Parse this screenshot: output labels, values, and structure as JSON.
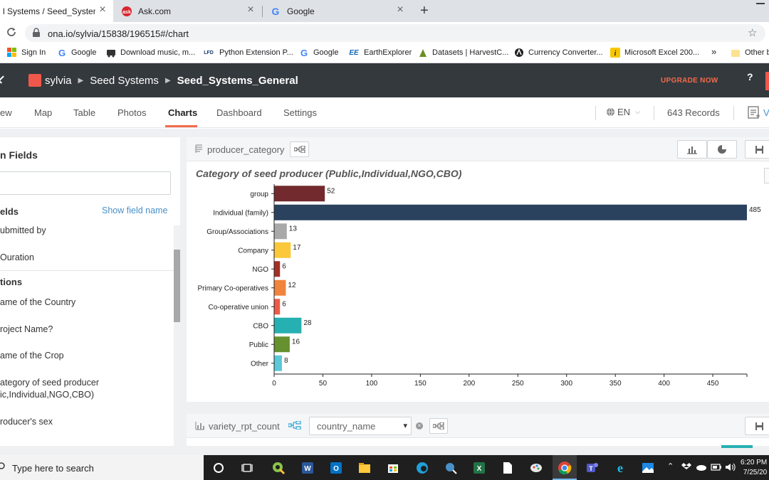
{
  "browser": {
    "tabs": [
      {
        "title": "l Systems / Seed_Systems_Ge",
        "active": true,
        "favicon": "ona-icon"
      },
      {
        "title": "Ask.com",
        "active": false,
        "favicon": "ask-icon"
      },
      {
        "title": "Google",
        "active": false,
        "favicon": "google-icon"
      }
    ],
    "url": "ona.io/sylvia/15838/196515#/chart",
    "bookmarks": [
      {
        "label": "Sign In",
        "icon": "windows-icon"
      },
      {
        "label": "Google",
        "icon": "google-icon"
      },
      {
        "label": "Download music, m...",
        "icon": "music-icon"
      },
      {
        "label": "Python Extension P...",
        "icon": "lfd-icon"
      },
      {
        "label": "Google",
        "icon": "google-icon"
      },
      {
        "label": "EarthExplorer",
        "icon": "ee-icon"
      },
      {
        "label": "Datasets | HarvestC...",
        "icon": "harvest-icon"
      },
      {
        "label": "Currency Converter...",
        "icon": "currency-icon"
      },
      {
        "label": "Microsoft Excel 200...",
        "icon": "excel-icon"
      },
      {
        "label": "Other b",
        "icon": "folder-icon"
      }
    ],
    "bookmarks_more": "»",
    "lfd_text": "LFD",
    "ee_text": "EE"
  },
  "header": {
    "crumbs": [
      "sylvia",
      "Seed Systems",
      "Seed_Systems_General"
    ],
    "upgrade": "UPGRADE NOW",
    "help": "?"
  },
  "nav": {
    "tabs": [
      "ew",
      "Map",
      "Table",
      "Photos",
      "Charts",
      "Dashboard",
      "Settings"
    ],
    "active": "Charts",
    "lang": "EN",
    "records": "643 Records",
    "right_fragment": "V"
  },
  "sidebar": {
    "title": "n Fields",
    "section1": "elds",
    "show_field_name": "Show field name",
    "fields1": [
      "ubmitted by",
      "Ouration"
    ],
    "section2": "tions",
    "fields2": [
      "ame of the Country",
      "roject Name?",
      "ame of the Crop",
      "ategory of seed producer",
      "ic,Individual,NGO,CBO)",
      "roducer's sex"
    ]
  },
  "card1": {
    "field": "producer_category"
  },
  "card2": {
    "field": "variety_rpt_count",
    "select_value": "country_name"
  },
  "taskbar": {
    "search_placeholder": "Type here to search",
    "time": "6:20 PM",
    "date": "7/25/20"
  },
  "colors": {
    "header_bg": "#34393e",
    "accent": "#f26b4a",
    "link": "#4a90c8"
  },
  "chart_data": {
    "type": "bar",
    "orientation": "horizontal",
    "title": "Category of seed producer (Public,Individual,NGO,CBO)",
    "categories": [
      "group",
      "Individual (family)",
      "Group/Associations",
      "Company",
      "NGO",
      "Primary Co-operatives",
      "Co-operative union",
      "CBO",
      "Public",
      "Other"
    ],
    "values": [
      52,
      485,
      13,
      17,
      6,
      12,
      6,
      28,
      16,
      8
    ],
    "colors": [
      "#722a2e",
      "#2b425e",
      "#a9a9a9",
      "#fac83a",
      "#a32f25",
      "#f0843c",
      "#ed5b47",
      "#26b0b1",
      "#65912f",
      "#5cc8d8"
    ],
    "xticks": [
      0,
      50,
      100,
      150,
      200,
      250,
      300,
      350,
      400,
      450
    ],
    "xlim": [
      0,
      485
    ],
    "grid": false,
    "legend": "none"
  }
}
